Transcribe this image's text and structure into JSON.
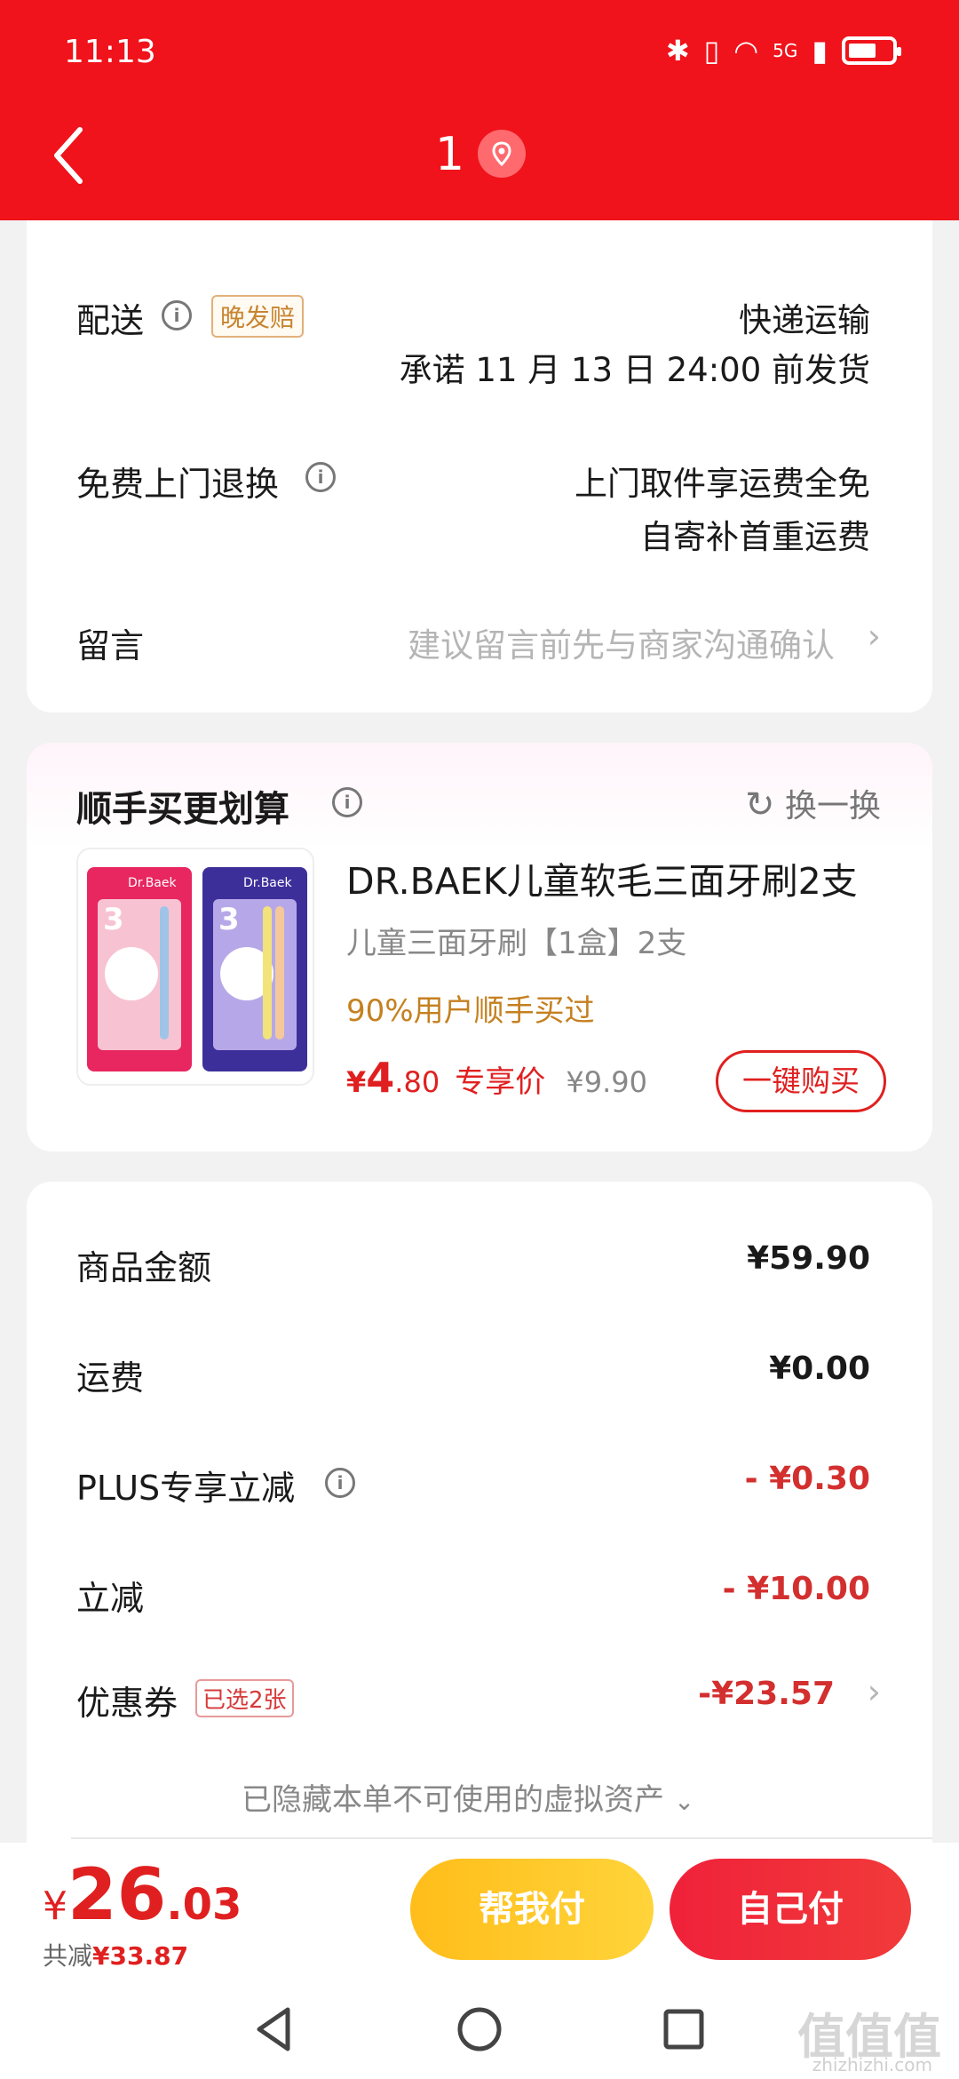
{
  "status_bar": {
    "time": "11:13",
    "network": "5G"
  },
  "header": {
    "title": "1",
    "back_icon": "chevron-left-icon",
    "location_icon": "map-pin-icon"
  },
  "order_info": {
    "delivery": {
      "label": "配送",
      "badge": "晚发赔",
      "method": "快递运输",
      "promise": "承诺 11 月 13 日 24:00 前发货"
    },
    "return": {
      "label": "免费上门退换",
      "line1": "上门取件享运费全免",
      "line2": "自寄补首重运费"
    },
    "message": {
      "label": "留言",
      "placeholder": "建议留言前先与商家沟通确认"
    }
  },
  "recommend": {
    "title": "顺手买更划算",
    "refresh_label": "换一换",
    "product": {
      "name": "DR.BAEK儿童软毛三面牙刷2支",
      "spec": "儿童三面牙刷【1盒】2支",
      "tip": "90%用户顺手买过",
      "price_symbol": "¥",
      "price_int": "4",
      "price_dec": ".80",
      "price_tag": "专享价",
      "original_price": "¥9.90",
      "buy_label": "一键购买",
      "image_brand": "Dr.Baek",
      "image_number": "3"
    }
  },
  "summary": {
    "rows": [
      {
        "label": "商品金额",
        "value": "¥59.90"
      },
      {
        "label": "运费",
        "value": "¥0.00"
      },
      {
        "label": "PLUS专享立减",
        "value": "- ¥0.30"
      },
      {
        "label": "立减",
        "value": "- ¥10.00"
      },
      {
        "label": "优惠券",
        "badge": "已选2张",
        "value": "-¥23.57"
      }
    ],
    "hidden_note": "已隐藏本单不可使用的虚拟资产"
  },
  "bottom_bar": {
    "currency": "¥",
    "total_int": "26",
    "total_dec": ".03",
    "saved_prefix": "共减",
    "saved_amount": "¥33.87",
    "help_pay_label": "帮我付",
    "self_pay_label": "自己付"
  },
  "watermark": {
    "text": "值值值",
    "sub": "zhizhizhi.com"
  },
  "colors": {
    "header_red": "#f0131b",
    "price_red": "#e02020",
    "yellow_btn": "#ffc526",
    "tip_orange": "#c58020"
  }
}
